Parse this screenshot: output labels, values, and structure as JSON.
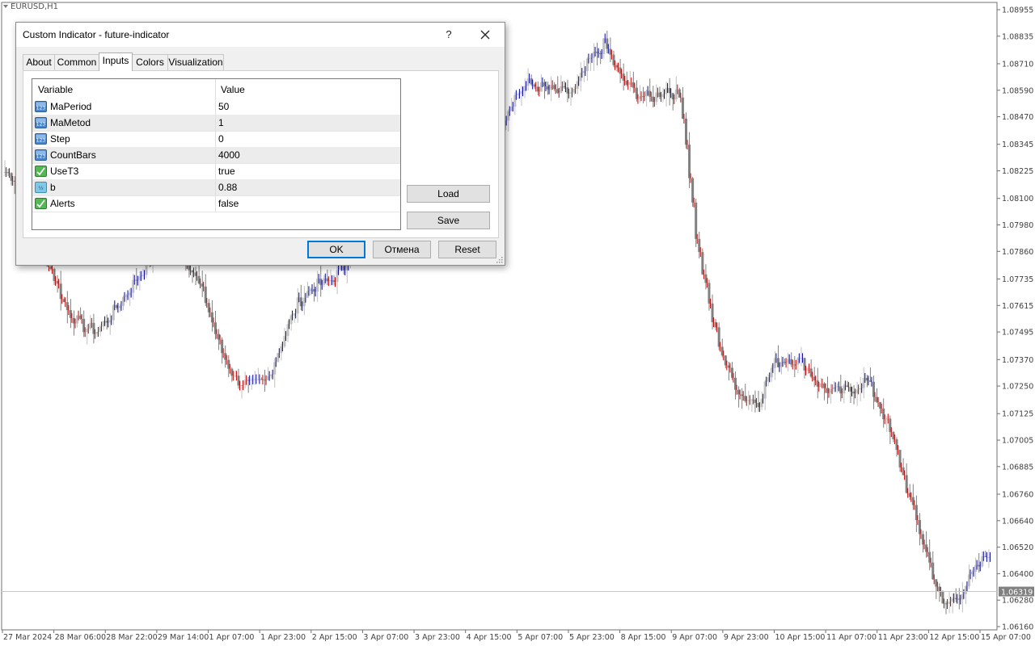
{
  "chart": {
    "symbol": "EURUSD,H1",
    "bid_label": "1.06319",
    "price_labels": [
      "1.08955",
      "1.08835",
      "1.08710",
      "1.08590",
      "1.08470",
      "1.08345",
      "1.08225",
      "1.08100",
      "1.07980",
      "1.07860",
      "1.07735",
      "1.07615",
      "1.07495",
      "1.07370",
      "1.07250",
      "1.07125",
      "1.07005",
      "1.06885",
      "1.06760",
      "1.06640",
      "1.06520",
      "1.06400",
      "1.06280",
      "1.06160"
    ],
    "time_labels": [
      "27 Mar 2024",
      "28 Mar 06:00",
      "28 Mar 22:00",
      "29 Mar 14:00",
      "1 Apr 07:00",
      "1 Apr 23:00",
      "2 Apr 15:00",
      "3 Apr 07:00",
      "3 Apr 23:00",
      "4 Apr 15:00",
      "5 Apr 07:00",
      "5 Apr 23:00",
      "8 Apr 15:00",
      "9 Apr 07:00",
      "9 Apr 23:00",
      "10 Apr 15:00",
      "11 Apr 07:00",
      "11 Apr 23:00",
      "12 Apr 15:00",
      "15 Apr 07:00"
    ],
    "colors": {
      "bull": "#c0c0c0",
      "bear": "#808080",
      "up_indicator": "#0000a0",
      "down_indicator": "#c00000",
      "axis": "#606060"
    },
    "price_path": [
      1.0822,
      1.0818,
      1.0795,
      1.0778,
      1.076,
      1.0752,
      1.075,
      1.0758,
      1.0768,
      1.0778,
      1.079,
      1.0792,
      1.078,
      1.0765,
      1.0742,
      1.0728,
      1.0725,
      1.0727,
      1.0745,
      1.0762,
      1.077,
      1.0772,
      1.0778,
      1.0795,
      1.082,
      1.0832,
      1.083,
      1.0828,
      1.0832,
      1.0835,
      1.0828,
      1.0826,
      1.0838,
      1.0855,
      1.0862,
      1.086,
      1.0858,
      1.0858,
      1.0872,
      1.088,
      1.0865,
      1.0858,
      1.0855,
      1.086,
      1.0855,
      1.079,
      1.0755,
      1.0732,
      1.072,
      1.0718,
      1.0735,
      1.0738,
      1.0735,
      1.0725,
      1.0722,
      1.0723,
      1.0728,
      1.0715,
      1.0695,
      1.067,
      1.0648,
      1.0625,
      1.063,
      1.064,
      1.065
    ]
  },
  "dialog": {
    "title": "Custom Indicator - future-indicator",
    "help_label": "?",
    "tabs": [
      "About",
      "Common",
      "Inputs",
      "Colors",
      "Visualization"
    ],
    "active_tab": "Inputs",
    "columns": {
      "variable": "Variable",
      "value": "Value"
    },
    "params": [
      {
        "name": "MaPeriod",
        "value": "50",
        "type": "int-icon"
      },
      {
        "name": "MaMetod",
        "value": "1",
        "type": "int-icon"
      },
      {
        "name": "Step",
        "value": "0",
        "type": "int-icon"
      },
      {
        "name": "CountBars",
        "value": "4000",
        "type": "int-icon"
      },
      {
        "name": "UseT3",
        "value": "true",
        "type": "bool-icon"
      },
      {
        "name": "b",
        "value": "0.88",
        "type": "double-icon"
      },
      {
        "name": "Alerts",
        "value": "false",
        "type": "bool-icon"
      }
    ],
    "buttons": {
      "load": "Load",
      "save": "Save",
      "ok": "OK",
      "cancel": "Отмена",
      "reset": "Reset"
    }
  }
}
